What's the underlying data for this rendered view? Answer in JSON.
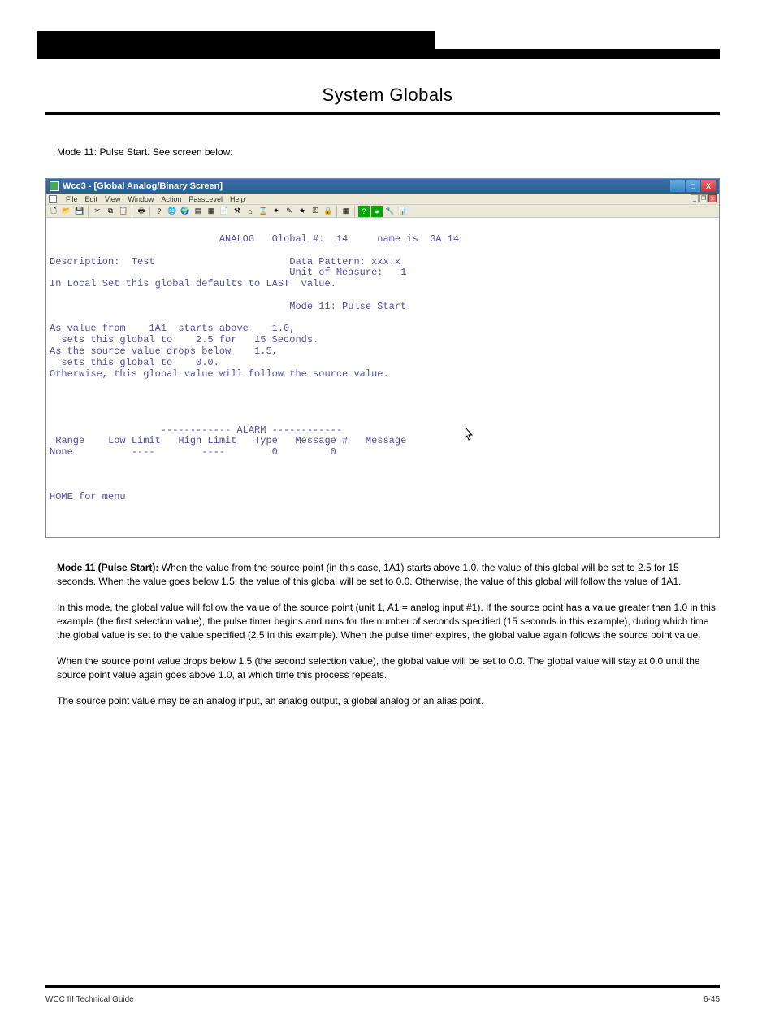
{
  "header_title": "System Globals",
  "intro": "Mode 11: Pulse Start.  See screen below:",
  "window": {
    "title": "Wcc3 - [Global Analog/Binary Screen]",
    "menu": [
      "File",
      "Edit",
      "View",
      "Window",
      "Action",
      "PassLevel",
      "Help"
    ]
  },
  "screen": {
    "line_title": "                             ANALOG   Global #:  14     name is  GA 14",
    "desc_label": "Description:  Test",
    "data_pattern": "Data Pattern: xxx.x",
    "unit_measure": "Unit of Measure:   1",
    "local_set": "In Local Set this global defaults to LAST  value.",
    "mode": "Mode 11: Pulse Start",
    "body1": "As value from    1A1  starts above    1.0,",
    "body2": "  sets this global to    2.5 for   15 Seconds.",
    "body3": "As the source value drops below    1.5,",
    "body4": "  sets this global to    0.0.",
    "body5": "Otherwise, this global value will follow the source value.",
    "alarm_header": "                   ------------ ALARM ------------",
    "alarm_cols": " Range    Low Limit   High Limit   Type   Message #   Message",
    "alarm_row": "None          ----        ----        0         0",
    "home": "HOME for menu"
  },
  "explain": {
    "p1_label": "Mode 11 (Pulse Start):",
    "p1_text": "  When the value from the source point (in this case, 1A1) starts above 1.0, the value of this global will be set to 2.5 for 15 seconds.  When the value goes below 1.5, the value of this global will be set to 0.0.  Otherwise, the value of this global will follow the value of 1A1.",
    "p2": "In this mode, the global value will follow the value of the source point (unit 1, A1 = analog input #1).  If the source point has a value greater than 1.0 in this example (the first selection value), the pulse timer begins and runs for the number of seconds specified (15 seconds in this example), during which time the global value is set to the value specified (2.5 in this example).  When the pulse timer expires, the global value again follows the source point value.",
    "p3": "When the source point value drops below 1.5 (the second selection value), the global value will be set to 0.0.  The global value will stay at 0.0 until the source point value again goes above 1.0, at which time this process repeats.",
    "p4": "The source point value may be an analog input, an analog output, a global analog or an alias point."
  },
  "footer": {
    "left": "WCC III Technical Guide",
    "right": "6-45"
  }
}
